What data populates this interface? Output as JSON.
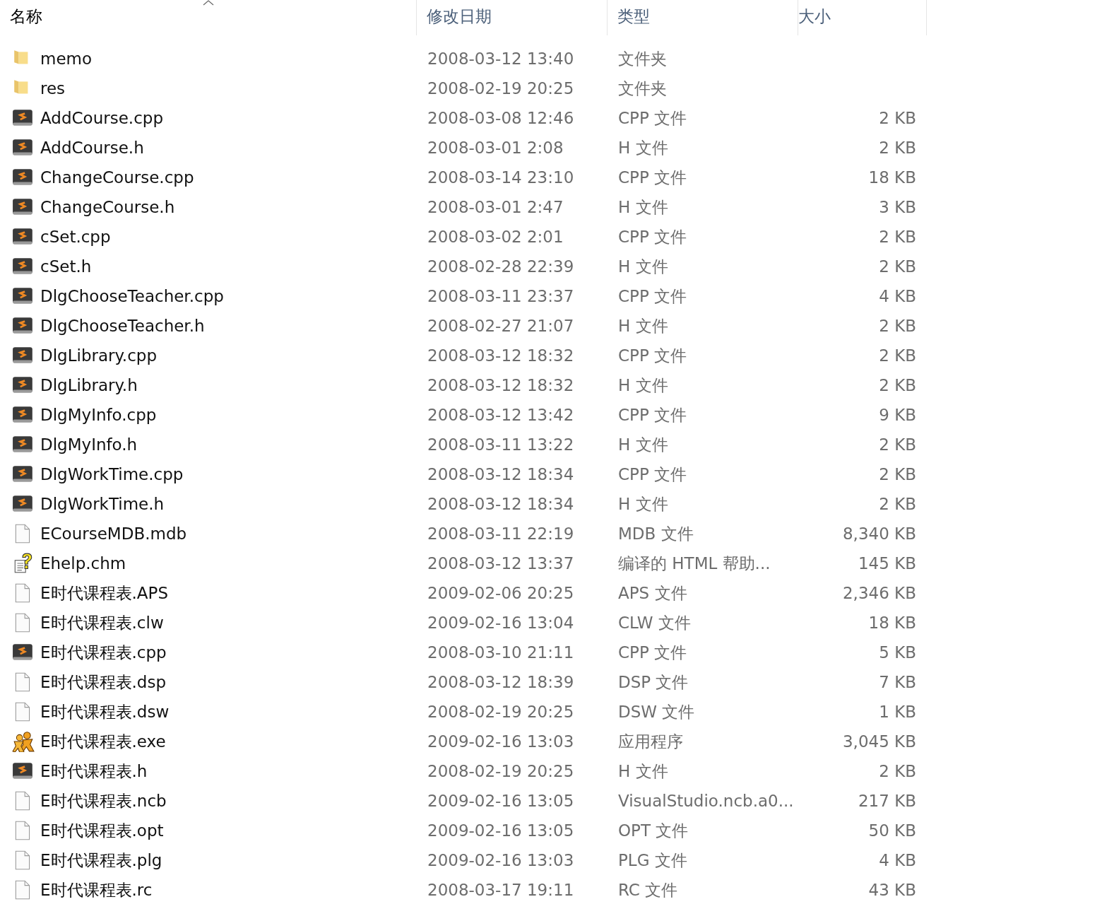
{
  "columns": [
    {
      "label": "名称",
      "sorted": true
    },
    {
      "label": "修改日期",
      "sorted": false
    },
    {
      "label": "类型",
      "sorted": false
    },
    {
      "label": "大小",
      "sorted": false
    }
  ],
  "rows": [
    {
      "kind": "folder",
      "name": "memo",
      "modified": "2008-03-12 13:40",
      "type": "文件夹"
    },
    {
      "kind": "folder",
      "name": "res",
      "modified": "2008-02-19 20:25",
      "type": "文件夹"
    },
    {
      "kind": "source",
      "name": "AddCourse.cpp",
      "modified": "2008-03-08 12:46",
      "type": "CPP 文件",
      "size": "2 KB"
    },
    {
      "kind": "source",
      "name": "AddCourse.h",
      "modified": "2008-03-01 2:08",
      "type": "H 文件",
      "size": "2 KB"
    },
    {
      "kind": "source",
      "name": "ChangeCourse.cpp",
      "modified": "2008-03-14 23:10",
      "type": "CPP 文件",
      "size": "18 KB"
    },
    {
      "kind": "source",
      "name": "ChangeCourse.h",
      "modified": "2008-03-01 2:47",
      "type": "H 文件",
      "size": "3 KB"
    },
    {
      "kind": "source",
      "name": "cSet.cpp",
      "modified": "2008-03-02 2:01",
      "type": "CPP 文件",
      "size": "2 KB"
    },
    {
      "kind": "source",
      "name": "cSet.h",
      "modified": "2008-02-28 22:39",
      "type": "H 文件",
      "size": "2 KB"
    },
    {
      "kind": "source",
      "name": "DlgChooseTeacher.cpp",
      "modified": "2008-03-11 23:37",
      "type": "CPP 文件",
      "size": "4 KB"
    },
    {
      "kind": "source",
      "name": "DlgChooseTeacher.h",
      "modified": "2008-02-27 21:07",
      "type": "H 文件",
      "size": "2 KB"
    },
    {
      "kind": "source",
      "name": "DlgLibrary.cpp",
      "modified": "2008-03-12 18:32",
      "type": "CPP 文件",
      "size": "2 KB"
    },
    {
      "kind": "source",
      "name": "DlgLibrary.h",
      "modified": "2008-03-12 18:32",
      "type": "H 文件",
      "size": "2 KB"
    },
    {
      "kind": "source",
      "name": "DlgMyInfo.cpp",
      "modified": "2008-03-12 13:42",
      "type": "CPP 文件",
      "size": "9 KB"
    },
    {
      "kind": "source",
      "name": "DlgMyInfo.h",
      "modified": "2008-03-11 13:22",
      "type": "H 文件",
      "size": "2 KB"
    },
    {
      "kind": "source",
      "name": "DlgWorkTime.cpp",
      "modified": "2008-03-12 18:34",
      "type": "CPP 文件",
      "size": "2 KB"
    },
    {
      "kind": "source",
      "name": "DlgWorkTime.h",
      "modified": "2008-03-12 18:34",
      "type": "H 文件",
      "size": "2 KB"
    },
    {
      "kind": "blank",
      "name": "ECourseMDB.mdb",
      "modified": "2008-03-11 22:19",
      "type": "MDB 文件",
      "size": "8,340 KB"
    },
    {
      "kind": "help",
      "name": "Ehelp.chm",
      "modified": "2008-03-12 13:37",
      "type": "编译的 HTML 帮助...",
      "size": "145 KB"
    },
    {
      "kind": "blank",
      "name": "E时代课程表.APS",
      "modified": "2009-02-06 20:25",
      "type": "APS 文件",
      "size": "2,346 KB"
    },
    {
      "kind": "blank",
      "name": "E时代课程表.clw",
      "modified": "2009-02-16 13:04",
      "type": "CLW 文件",
      "size": "18 KB"
    },
    {
      "kind": "source",
      "name": "E时代课程表.cpp",
      "modified": "2008-03-10 21:11",
      "type": "CPP 文件",
      "size": "5 KB"
    },
    {
      "kind": "blank",
      "name": "E时代课程表.dsp",
      "modified": "2008-03-12 18:39",
      "type": "DSP 文件",
      "size": "7 KB"
    },
    {
      "kind": "blank",
      "name": "E时代课程表.dsw",
      "modified": "2008-02-19 20:25",
      "type": "DSW 文件",
      "size": "1 KB"
    },
    {
      "kind": "app",
      "name": "E时代课程表.exe",
      "modified": "2009-02-16 13:03",
      "type": "应用程序",
      "size": "3,045 KB"
    },
    {
      "kind": "source",
      "name": "E时代课程表.h",
      "modified": "2008-02-19 20:25",
      "type": "H 文件",
      "size": "2 KB"
    },
    {
      "kind": "blank",
      "name": "E时代课程表.ncb",
      "modified": "2009-02-16 13:05",
      "type": "VisualStudio.ncb.a0...",
      "size": "217 KB"
    },
    {
      "kind": "blank",
      "name": "E时代课程表.opt",
      "modified": "2009-02-16 13:05",
      "type": "OPT 文件",
      "size": "50 KB"
    },
    {
      "kind": "blank",
      "name": "E时代课程表.plg",
      "modified": "2009-02-16 13:03",
      "type": "PLG 文件",
      "size": "4 KB"
    },
    {
      "kind": "blank",
      "name": "E时代课程表.rc",
      "modified": "2008-03-17 19:11",
      "type": "RC 文件",
      "size": "43 KB"
    }
  ]
}
